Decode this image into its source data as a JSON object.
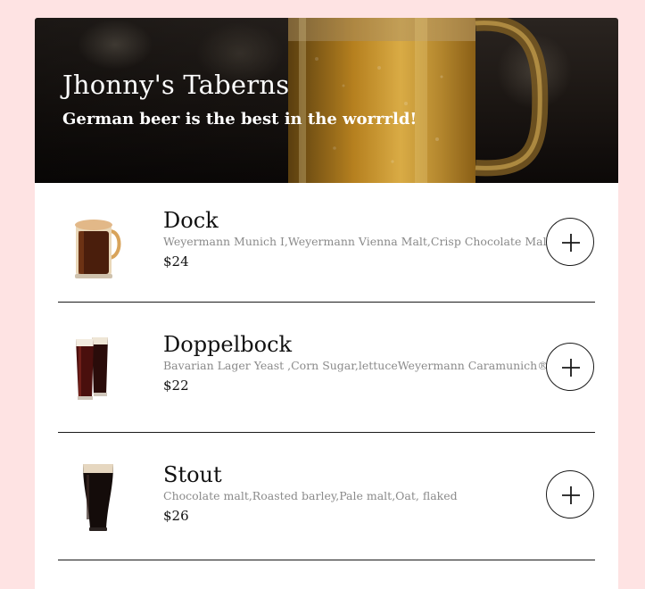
{
  "header": {
    "title": "Jhonny's Taberns",
    "subtitle": "German beer is the best in the worrrld!"
  },
  "menu": {
    "items": [
      {
        "name": "Dock",
        "description": "Weyermann Munich I,Weyermann Vienna Malt,Crisp Chocolate Malt",
        "price": "$24",
        "icon": "beer-mug-icon"
      },
      {
        "name": "Doppelbock",
        "description": "Bavarian Lager Yeast ,Corn Sugar,lettuceWeyermann Caramunich® I",
        "price": "$22",
        "icon": "beer-glasses-icon"
      },
      {
        "name": "Stout",
        "description": "Chocolate malt,Roasted barley,Pale malt,Oat, flaked",
        "price": "$26",
        "icon": "stout-glass-icon"
      }
    ]
  },
  "colors": {
    "page_background": "#fee3e3",
    "card_background": "#ffffff",
    "description_text": "#8a8a8a",
    "dark_text": "#111111"
  }
}
